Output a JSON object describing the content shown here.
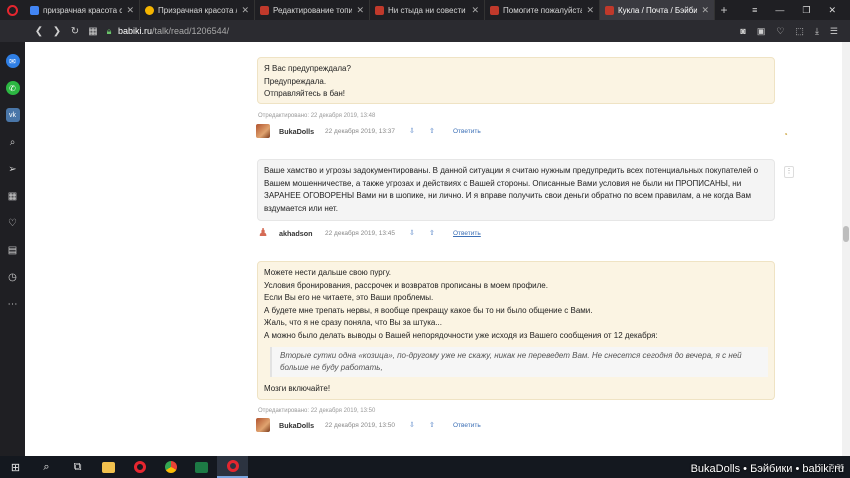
{
  "browser": {
    "tabs": [
      {
        "label": "призрачная красота си",
        "favicon_color": "#4285f4",
        "active": false
      },
      {
        "label": "Призрачная красота / С",
        "favicon_color": "#f4b400",
        "active": false
      },
      {
        "label": "Редактирование топика",
        "favicon_color": "#c0392b",
        "active": false
      },
      {
        "label": "Ни стыда ни совести / Б",
        "favicon_color": "#c0392b",
        "active": false
      },
      {
        "label": "Помогите пожалуйста р",
        "favicon_color": "#c0392b",
        "active": false
      },
      {
        "label": "Кукла / Почта / Бэйбик",
        "favicon_color": "#c0392b",
        "active": true
      }
    ],
    "new_tab_icon": "+",
    "url_host": "babiki.ru",
    "url_path": "/talk/read/1206544/"
  },
  "comments": [
    {
      "bg": "yellow",
      "lines": [
        "Я Вас предупреждала?",
        "Предупреждала.",
        "Отправляйтесь в бан!"
      ],
      "edited": "Отредактировано: 22 декабря 2019, 13:48",
      "author": "BukaDolls",
      "date": "22 декабря 2019, 13:37",
      "reply": "Ответить"
    },
    {
      "bg": "grey",
      "lines": [
        "Ваше хамство и угрозы задокументированы. В данной ситуации я считаю нужным предупредить всех потенциальных покупателей о Вашем мошенничестве, а также угрозах и действиях с Вашей стороны. Описанные Вами условия не были ни ПРОПИСАНЫ, ни ЗАРАНЕЕ ОГОВОРЕНЫ Вами ни в шопике, ни лично. И я вправе получить свои деньги обратно по всем правилам, а не когда Вам вздумается или нет."
      ],
      "author": "akhadson",
      "date": "22 декабря 2019, 13:45",
      "reply": "Ответить"
    },
    {
      "bg": "yellow",
      "lines": [
        "Можете нести дальше свою пургу.",
        "Условия бронирования, рассрочек и возвратов прописаны в моем профиле.",
        "Если Вы его не читаете, это Ваши проблемы.",
        "А будете мне трепать нервы, я вообще прекращу какое бы то ни было общение с Вами.",
        "Жаль, что я не сразу поняла, что Вы за штука...",
        "А можно было делать выводы о Вашей непорядочности уже исходя из Вашего сообщения от 12 декабря:"
      ],
      "quote": "Вторые сутки одна «козица», по-другому уже не скажу, никак не переведет Вам. Не снесется сегодня до вечера, я с ней больше не буду работать,",
      "closing": "Мозги включайте!",
      "edited": "Отредактировано: 22 декабря 2019, 13:50",
      "author": "BukaDolls",
      "date": "22 декабря 2019, 13:50",
      "reply": "Ответить"
    }
  ],
  "taskbar": {
    "clock_time": "5:36",
    "watermark": "BukaDolls • Бэйбики • babiki.ru"
  }
}
